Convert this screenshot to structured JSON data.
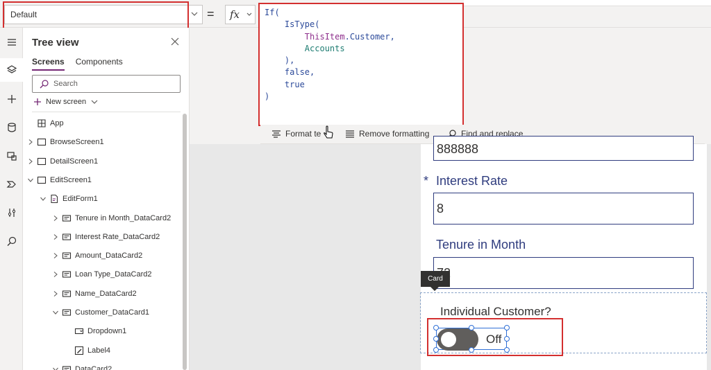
{
  "formula_bar": {
    "property_value": "Default",
    "fx_label": "fx",
    "equals": "=",
    "formula_lines": [
      {
        "indent": "",
        "parts": [
          {
            "t": "If(",
            "c": "fn"
          }
        ]
      },
      {
        "indent": "    ",
        "parts": [
          {
            "t": "IsType(",
            "c": "fn"
          }
        ]
      },
      {
        "indent": "        ",
        "parts": [
          {
            "t": "ThisItem",
            "c": "str"
          },
          {
            "t": ".Customer,",
            "c": "fn"
          }
        ]
      },
      {
        "indent": "        ",
        "parts": [
          {
            "t": "Accounts",
            "c": "enum"
          }
        ]
      },
      {
        "indent": "    ",
        "parts": [
          {
            "t": "),",
            "c": "fn"
          }
        ]
      },
      {
        "indent": "    ",
        "parts": [
          {
            "t": "false,",
            "c": "fn"
          }
        ]
      },
      {
        "indent": "    ",
        "parts": [
          {
            "t": "true",
            "c": "fn"
          }
        ]
      },
      {
        "indent": "",
        "parts": [
          {
            "t": ")",
            "c": "fn"
          }
        ]
      }
    ]
  },
  "format_toolbar": {
    "format_text": "Format te",
    "remove_formatting": "Remove formatting",
    "find_replace": "Find and replace"
  },
  "rail_icons": [
    "hamburger-icon",
    "layers-icon",
    "plus-icon",
    "database-icon",
    "media-icon",
    "advanced-tools-icon",
    "variables-icon",
    "search-icon"
  ],
  "tree_view": {
    "title": "Tree view",
    "tabs": [
      "Screens",
      "Components"
    ],
    "search_placeholder": "Search",
    "new_screen": "New screen",
    "rows": [
      {
        "label": "App",
        "level": 0,
        "chevron": "none",
        "icon": "app"
      },
      {
        "label": "BrowseScreen1",
        "level": 0,
        "chevron": "right",
        "icon": "screen"
      },
      {
        "label": "DetailScreen1",
        "level": 0,
        "chevron": "right",
        "icon": "screen"
      },
      {
        "label": "EditScreen1",
        "level": 0,
        "chevron": "down",
        "icon": "screen"
      },
      {
        "label": "EditForm1",
        "level": 1,
        "chevron": "down",
        "icon": "form"
      },
      {
        "label": "Tenure in Month_DataCard2",
        "level": 2,
        "chevron": "right",
        "icon": "card"
      },
      {
        "label": "Interest Rate_DataCard2",
        "level": 2,
        "chevron": "right",
        "icon": "card"
      },
      {
        "label": "Amount_DataCard2",
        "level": 2,
        "chevron": "right",
        "icon": "card"
      },
      {
        "label": "Loan Type_DataCard2",
        "level": 2,
        "chevron": "right",
        "icon": "card"
      },
      {
        "label": "Name_DataCard2",
        "level": 2,
        "chevron": "right",
        "icon": "card"
      },
      {
        "label": "Customer_DataCard1",
        "level": 2,
        "chevron": "down",
        "icon": "card"
      },
      {
        "label": "Dropdown1",
        "level": 3,
        "chevron": "none",
        "icon": "dropdown"
      },
      {
        "label": "Label4",
        "level": 3,
        "chevron": "none",
        "icon": "label"
      },
      {
        "label": "DataCard2",
        "level": 2,
        "chevron": "down",
        "icon": "card"
      }
    ]
  },
  "form": {
    "partial_value": "888888",
    "interest_label": "Interest Rate",
    "required_star": "*",
    "interest_value": "8",
    "tenure_label": "Tenure in Month",
    "tenure_value": "72",
    "tooltip": "Card",
    "customer_label": "Individual Customer?",
    "toggle_text": "Off"
  },
  "colors": {
    "highlight_box": "#d32f2f",
    "accent": "#742774",
    "field_text": "#2f3c7e",
    "selection": "#2f6fd6"
  }
}
